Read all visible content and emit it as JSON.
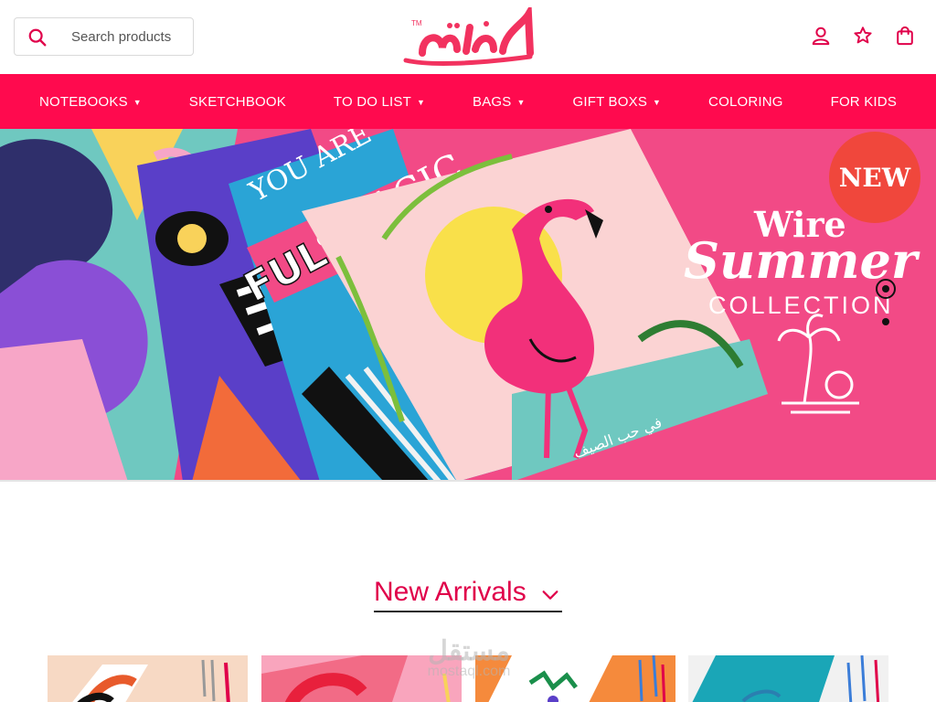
{
  "header": {
    "search": {
      "placeholder": "Search products",
      "value": "",
      "icon": "search-icon"
    },
    "logo": {
      "text": "مفكرة",
      "trademark": "TM",
      "color": "#f2325f"
    },
    "actions": [
      {
        "icon": "user-icon"
      },
      {
        "icon": "star-icon"
      },
      {
        "icon": "shopping-bag-icon"
      }
    ],
    "accent": "#e0004a"
  },
  "nav": {
    "background": "#ff0a4e",
    "items": [
      {
        "label": "NOTEBOOKS",
        "dropdown": true
      },
      {
        "label": "SKETCHBOOK",
        "dropdown": false
      },
      {
        "label": "TO DO LIST",
        "dropdown": true
      },
      {
        "label": "BAGS",
        "dropdown": true
      },
      {
        "label": "GIFT BOXS",
        "dropdown": true
      },
      {
        "label": "COLORING",
        "dropdown": false
      },
      {
        "label": "FOR KIDS",
        "dropdown": false
      }
    ]
  },
  "hero": {
    "badge": "NEW",
    "line1": "Wire",
    "line2": "Summer",
    "line3": "COLLECTION",
    "notebook_text_1": "YOU ARE",
    "notebook_text_2": "FULL",
    "notebook_text_3": "OF",
    "notebook_text_4": "MAGIC",
    "arabic_caption": "في حب الصيف",
    "slides_total": 2,
    "active_slide": 1
  },
  "section": {
    "title": "New Arrivals",
    "chevron_icon": "chevron-down-icon"
  },
  "watermark": {
    "line1": "مستقل",
    "line2": "mostaql.com"
  },
  "products": [
    {
      "color": "#f7d9c4",
      "accent": "#e85a2b"
    },
    {
      "color": "#f9a5bd",
      "accent": "#f0406a"
    },
    {
      "color": "#f58a3c",
      "accent": "#ffffff"
    },
    {
      "color": "#f1f1f1",
      "accent": "#1aa6b7"
    }
  ]
}
